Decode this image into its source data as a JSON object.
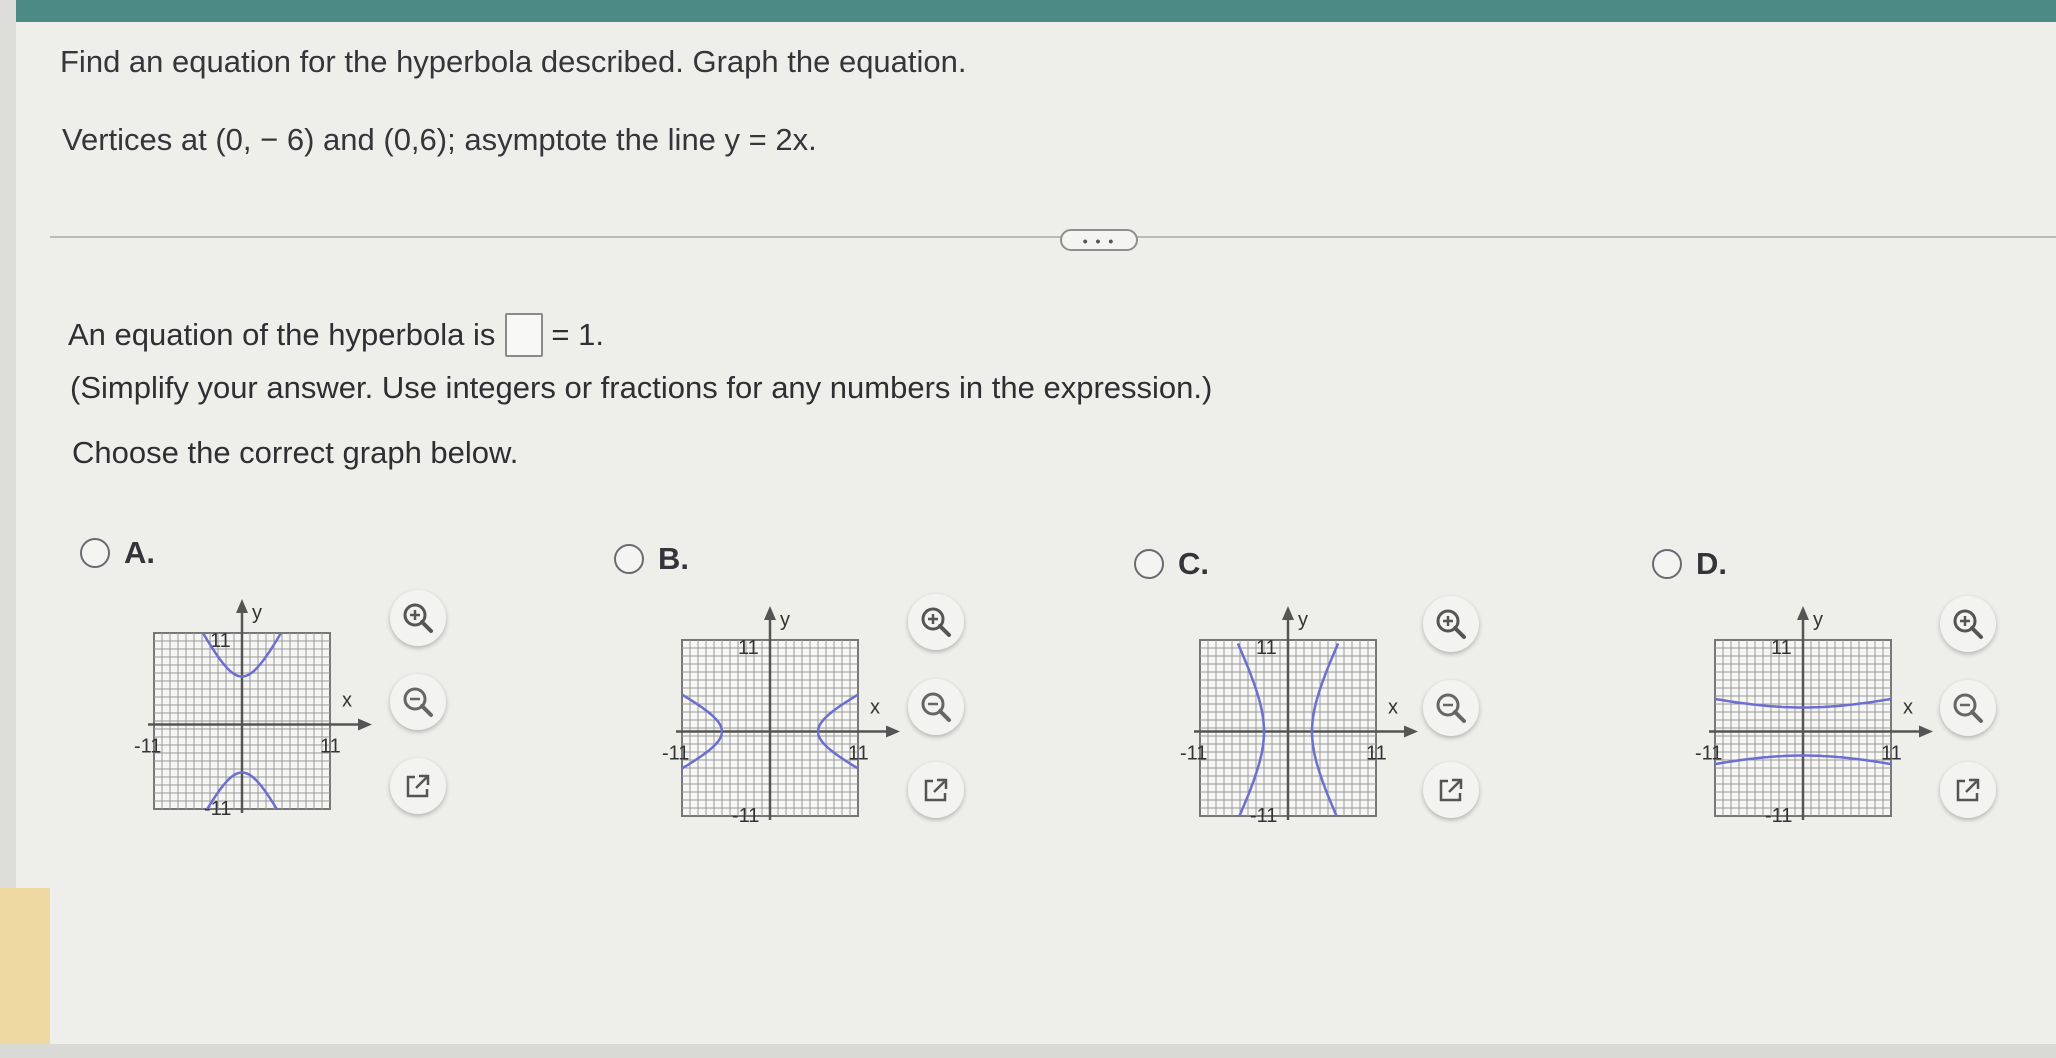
{
  "question": {
    "line1": "Find an equation for the hyperbola described. Graph the equation.",
    "line2": "Vertices at (0, − 6) and (0,6); asymptote the line y = 2x."
  },
  "more_label": "• • •",
  "answer": {
    "prefix": "An equation of the hyperbola is",
    "suffix": "= 1.",
    "box_value": "",
    "hint": "(Simplify your answer. Use integers or fractions for any numbers in the expression.)"
  },
  "choose_label": "Choose the correct graph below.",
  "graph_labels": {
    "y": "y",
    "x": "x",
    "top": "11",
    "bottom": "-11",
    "left": "-11",
    "right": "11"
  },
  "options": [
    {
      "label": "A.",
      "orientation": "vertical-opening",
      "selected": false
    },
    {
      "label": "B.",
      "orientation": "horizontal-opening",
      "selected": false
    },
    {
      "label": "C.",
      "orientation": "horizontal-narrow",
      "selected": false
    },
    {
      "label": "D.",
      "orientation": "vertical-wide",
      "selected": false
    }
  ],
  "tools": [
    "zoom-in-icon",
    "zoom-out-icon",
    "popout-icon"
  ],
  "colors": {
    "curve": "#6b6fd0",
    "teal_bar": "#4c8a86",
    "grid": "#9a9a9a"
  }
}
